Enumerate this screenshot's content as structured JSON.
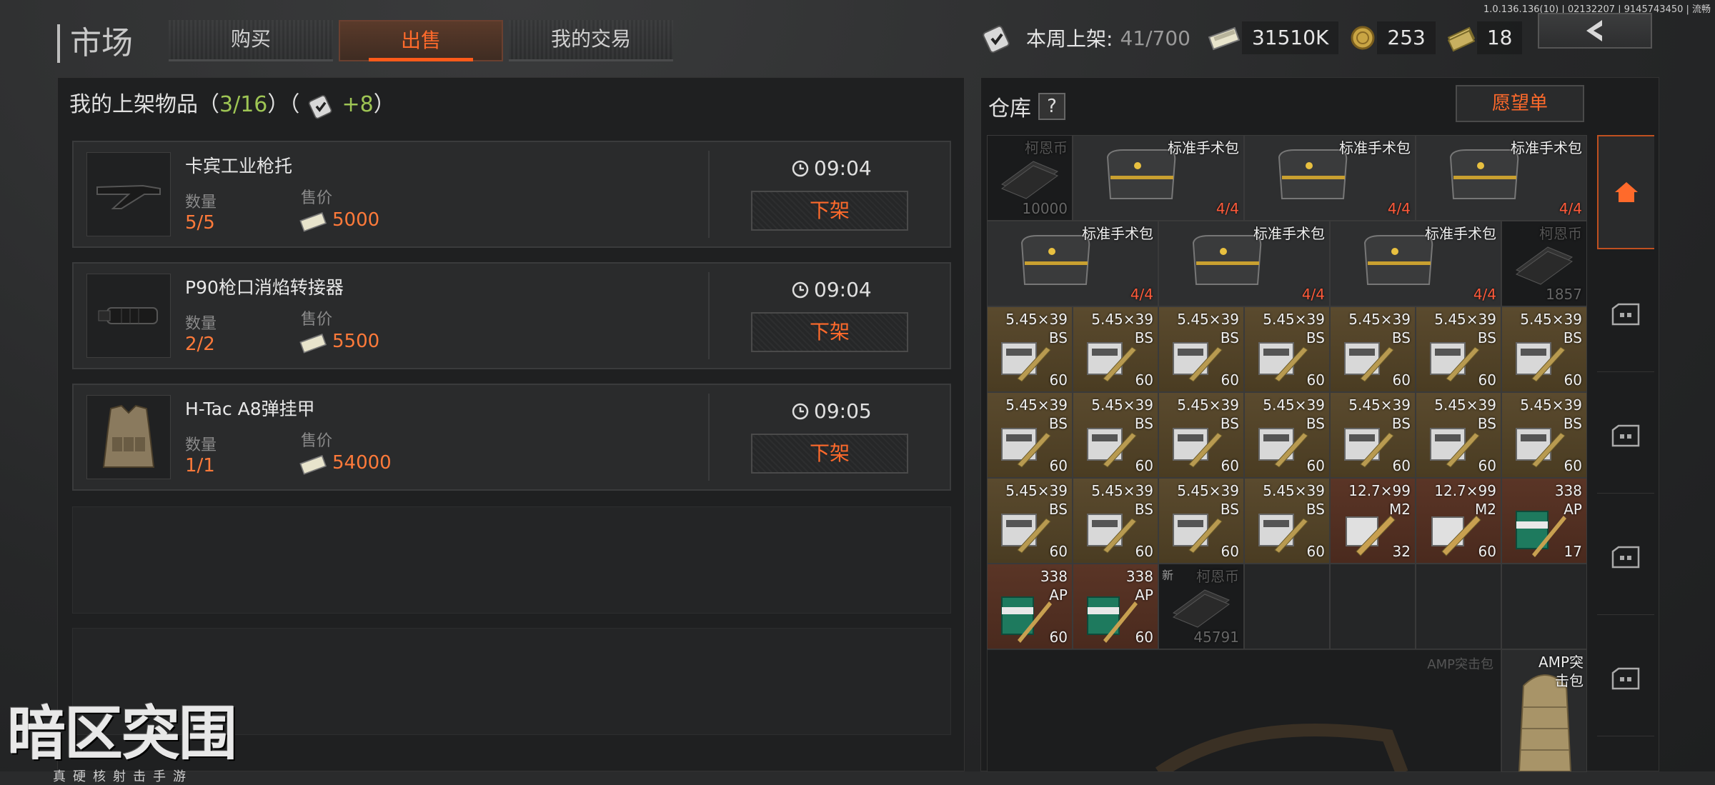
{
  "version": "1.0.136.136(10) | 02132207 | 9145743450 | 流畅",
  "header": {
    "title": "市场",
    "tabs": [
      {
        "label": "购买",
        "active": false
      },
      {
        "label": "出售",
        "active": true
      },
      {
        "label": "我的交易",
        "active": false
      }
    ],
    "weekly_label": "本周上架:",
    "weekly_value": "41/700",
    "money": "31510K",
    "coins": "253",
    "cash": "18"
  },
  "listings": {
    "title": "我的上架物品",
    "count": "3/16",
    "bonus": "+8",
    "qty_label": "数量",
    "price_label": "售价",
    "delist_label": "下架",
    "items": [
      {
        "name": "卡宾工业枪托",
        "qty": "5/5",
        "price": "5000",
        "time": "09:04"
      },
      {
        "name": "P90枪口消焰转接器",
        "qty": "2/2",
        "price": "5500",
        "time": "09:04"
      },
      {
        "name": "H-Tac A8弹挂甲",
        "qty": "1/1",
        "price": "54000",
        "time": "09:05"
      }
    ]
  },
  "warehouse": {
    "title": "仓库",
    "help": "?",
    "wishlist": "愿望单",
    "new_tag": "新",
    "cells": [
      {
        "title": "柯恩币",
        "count": "10000",
        "kind": "dark"
      },
      {
        "title": "标准手术包",
        "count": "4/4",
        "kind": "gray",
        "red": true
      },
      {
        "title": "标准手术包",
        "count": "4/4",
        "kind": "gray",
        "red": true
      },
      {
        "title": "标准手术包",
        "count": "4/4",
        "kind": "gray",
        "red": true
      },
      {
        "title": "标准手术包",
        "count": "4/4",
        "kind": "gray",
        "red": true
      },
      {
        "title": "标准手术包",
        "count": "4/4",
        "kind": "gray",
        "red": true
      },
      {
        "title": "标准手术包",
        "count": "4/4",
        "kind": "gray",
        "red": true
      },
      {
        "title": "柯恩币",
        "count": "1857",
        "kind": "dark"
      },
      {
        "title": "5.45×39\nBS",
        "count": "60",
        "kind": "ammo"
      },
      {
        "title": "5.45×39\nBS",
        "count": "60",
        "kind": "ammo"
      },
      {
        "title": "5.45×39\nBS",
        "count": "60",
        "kind": "ammo"
      },
      {
        "title": "5.45×39\nBS",
        "count": "60",
        "kind": "ammo"
      },
      {
        "title": "5.45×39\nBS",
        "count": "60",
        "kind": "ammo"
      },
      {
        "title": "5.45×39\nBS",
        "count": "60",
        "kind": "ammo"
      },
      {
        "title": "5.45×39\nBS",
        "count": "60",
        "kind": "ammo"
      },
      {
        "title": "5.45×39\nBS",
        "count": "60",
        "kind": "ammo"
      },
      {
        "title": "5.45×39\nBS",
        "count": "60",
        "kind": "ammo"
      },
      {
        "title": "5.45×39\nBS",
        "count": "60",
        "kind": "ammo"
      },
      {
        "title": "5.45×39\nBS",
        "count": "60",
        "kind": "ammo"
      },
      {
        "title": "5.45×39\nBS",
        "count": "60",
        "kind": "ammo"
      },
      {
        "title": "5.45×39\nBS",
        "count": "60",
        "kind": "ammo"
      },
      {
        "title": "5.45×39\nBS",
        "count": "60",
        "kind": "ammo"
      },
      {
        "title": "5.45×39\nBS",
        "count": "60",
        "kind": "ammo"
      },
      {
        "title": "5.45×39\nBS",
        "count": "60",
        "kind": "ammo"
      },
      {
        "title": "5.45×39\nBS",
        "count": "60",
        "kind": "ammo"
      },
      {
        "title": "5.45×39\nBS",
        "count": "60",
        "kind": "ammo"
      },
      {
        "title": "12.7×99\nM2",
        "count": "32",
        "kind": "red"
      },
      {
        "title": "12.7×99\nM2",
        "count": "60",
        "kind": "red"
      },
      {
        "title": "338\nAP",
        "count": "17",
        "kind": "red"
      },
      {
        "title": "338\nAP",
        "count": "60",
        "kind": "red"
      },
      {
        "title": "338\nAP",
        "count": "60",
        "kind": "red"
      },
      {
        "title": "柯恩币",
        "count": "45791",
        "kind": "dark",
        "new": true
      }
    ],
    "bag_title": "AMP突击包",
    "bag_title2": "AMP突击包"
  },
  "logo": {
    "main": "暗区突围",
    "sub": "真硬核射击手游"
  }
}
